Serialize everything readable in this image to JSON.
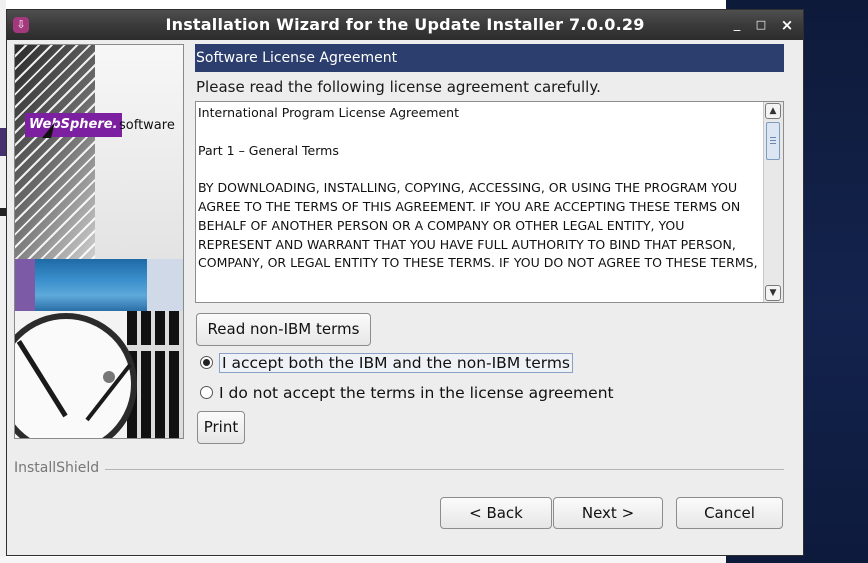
{
  "window": {
    "title": "Installation Wizard for the Update Installer 7.0.0.29",
    "min_glyph": "_",
    "max_glyph": "□",
    "close_glyph": "×"
  },
  "banner": {
    "logo_text": "WebSphere.",
    "logo_suffix": "software"
  },
  "panel": {
    "header": "Software License Agreement",
    "instruction": "Please read the following license agreement carefully.",
    "license_text": "International Program License Agreement\n\nPart 1 – General Terms\n\nBY DOWNLOADING, INSTALLING, COPYING, ACCESSING, OR USING THE PROGRAM YOU AGREE TO THE TERMS OF THIS AGREEMENT. IF YOU ARE ACCEPTING THESE TERMS ON BEHALF OF ANOTHER PERSON OR A COMPANY OR OTHER LEGAL ENTITY, YOU REPRESENT AND WARRANT THAT YOU HAVE FULL AUTHORITY TO BIND THAT PERSON, COMPANY, OR LEGAL ENTITY TO THESE TERMS. IF YOU DO NOT AGREE TO THESE TERMS,",
    "read_button": "Read non-IBM terms",
    "accept_label": "I accept both the IBM and the non-IBM terms",
    "decline_label": "I do not accept the terms in the license agreement",
    "print_button": "Print",
    "selected_option": "accept"
  },
  "footer": {
    "group_label": "InstallShield",
    "back_button": "< Back",
    "next_button": "Next >",
    "cancel_button": "Cancel"
  },
  "colors": {
    "header_bg": "#2c3e6e",
    "titlebar_bg": "#3a3a3a",
    "logo_bg": "#7c1fa0"
  }
}
